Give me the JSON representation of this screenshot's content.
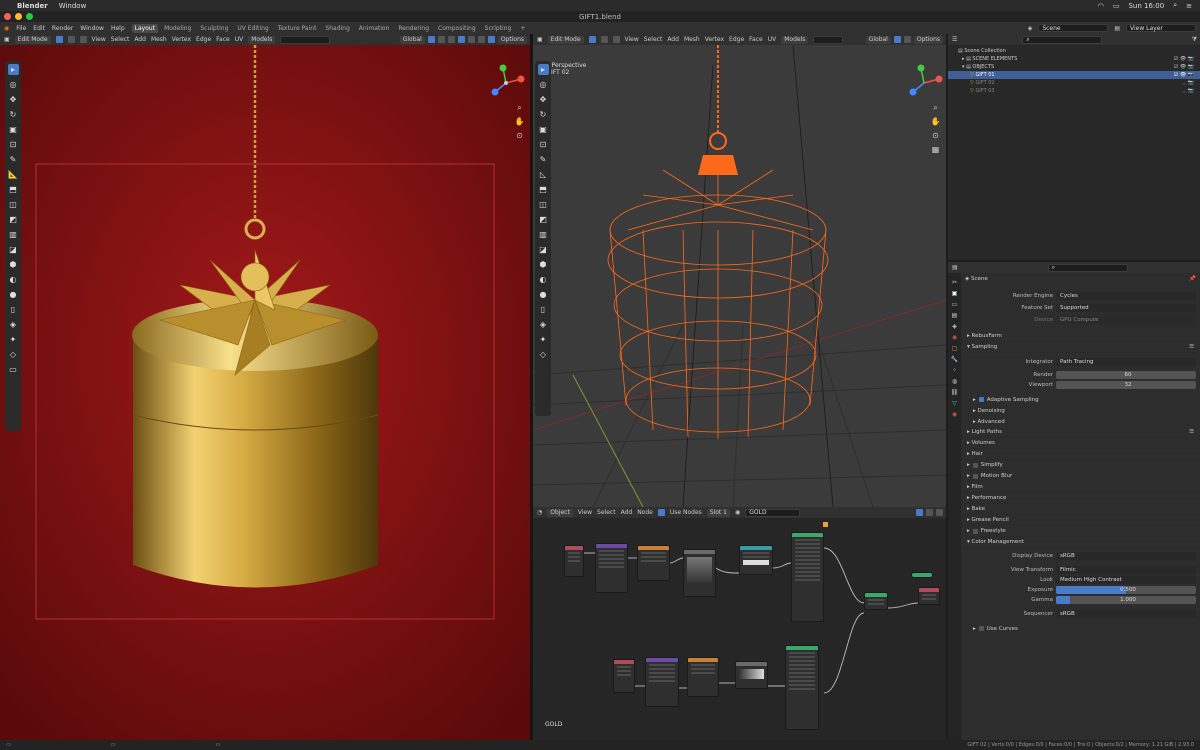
{
  "mac_menu": {
    "app": "Blender",
    "items": [
      "Window"
    ],
    "clock": "Sun 16:00"
  },
  "window_title": "GIFT1.blend",
  "menu": {
    "items": [
      "File",
      "Edit",
      "Render",
      "Window",
      "Help"
    ],
    "workspaces": [
      "Layout",
      "Modeling",
      "Sculpting",
      "UV Editing",
      "Texture Paint",
      "Shading",
      "Animation",
      "Rendering",
      "Compositing",
      "Scripting"
    ],
    "active_workspace": "Layout",
    "scene": "Scene",
    "view_layer": "View Layer"
  },
  "viewport_left": {
    "mode": "Edit Mode",
    "menus": [
      "View",
      "Select",
      "Add",
      "Mesh",
      "Vertex",
      "Edge",
      "Face",
      "UV"
    ],
    "transform": "Global",
    "options": "Options",
    "models": "Models"
  },
  "viewport_right": {
    "mode": "Edit Mode",
    "menus": [
      "View",
      "Select",
      "Add",
      "Mesh",
      "Vertex",
      "Edge",
      "Face",
      "UV"
    ],
    "transform": "Global",
    "options": "Options",
    "models": "Models",
    "overlay_title": "User Perspective",
    "overlay_object": "(1) GIFT 02"
  },
  "node_editor": {
    "type": "Object",
    "menus": [
      "View",
      "Select",
      "Add",
      "Node"
    ],
    "use_nodes": "Use Nodes",
    "slot": "Slot 1",
    "material": "GOLD",
    "label": "GOLD"
  },
  "outliner": {
    "root": "Scene Collection",
    "rows": [
      {
        "label": "SCENE ELEMENTS",
        "indent": 1
      },
      {
        "label": "OBJECTS",
        "indent": 1
      },
      {
        "label": "GIFT 01",
        "indent": 2,
        "selected": true
      },
      {
        "label": "GIFT 02",
        "indent": 2
      },
      {
        "label": "GIFT 03",
        "indent": 2
      }
    ]
  },
  "properties": {
    "scene_label": "Scene",
    "render_engine_label": "Render Engine",
    "render_engine": "Cycles",
    "feature_set_label": "Feature Set",
    "feature_set": "Supported",
    "device_label": "Device",
    "device": "GPU Compute",
    "panels_top": [
      "RebusFarm",
      "Sampling"
    ],
    "integrator_label": "Integrator",
    "integrator": "Path Tracing",
    "render_label": "Render",
    "render_samples": "60",
    "viewport_label": "Viewport",
    "viewport_samples": "32",
    "sub_panels": [
      "Adaptive Sampling",
      "Denoising",
      "Advanced"
    ],
    "panels_mid": [
      "Light Paths",
      "Volumes",
      "Hair",
      "Simplify",
      "Motion Blur",
      "Film",
      "Performance",
      "Bake",
      "Grease Pencil",
      "Freestyle",
      "Color Management"
    ],
    "display_device_label": "Display Device",
    "display_device": "sRGB",
    "view_transform_label": "View Transform",
    "view_transform": "Filmic",
    "look_label": "Look",
    "look": "Medium High Contrast",
    "exposure_label": "Exposure",
    "exposure": "0.500",
    "exposure_fraction": 0.5,
    "gamma_label": "Gamma",
    "gamma": "1.000",
    "gamma_fraction": 0.1,
    "sequencer_label": "Sequencer",
    "sequencer": "sRGB",
    "use_curves": "Use Curves"
  },
  "status_bar": {
    "text": "GIFT 02 | Verts:0/0 | Edges:0/0 | Faces:0/0 | Tris:0 | Objects:0/2 | Memory: 1.21 GiB | 2.93.0"
  },
  "colors": {
    "accent": "#4a7bc8",
    "wire": "#ff6a1a",
    "render_bg": "#8c1414",
    "gold": "#c9a43a"
  }
}
